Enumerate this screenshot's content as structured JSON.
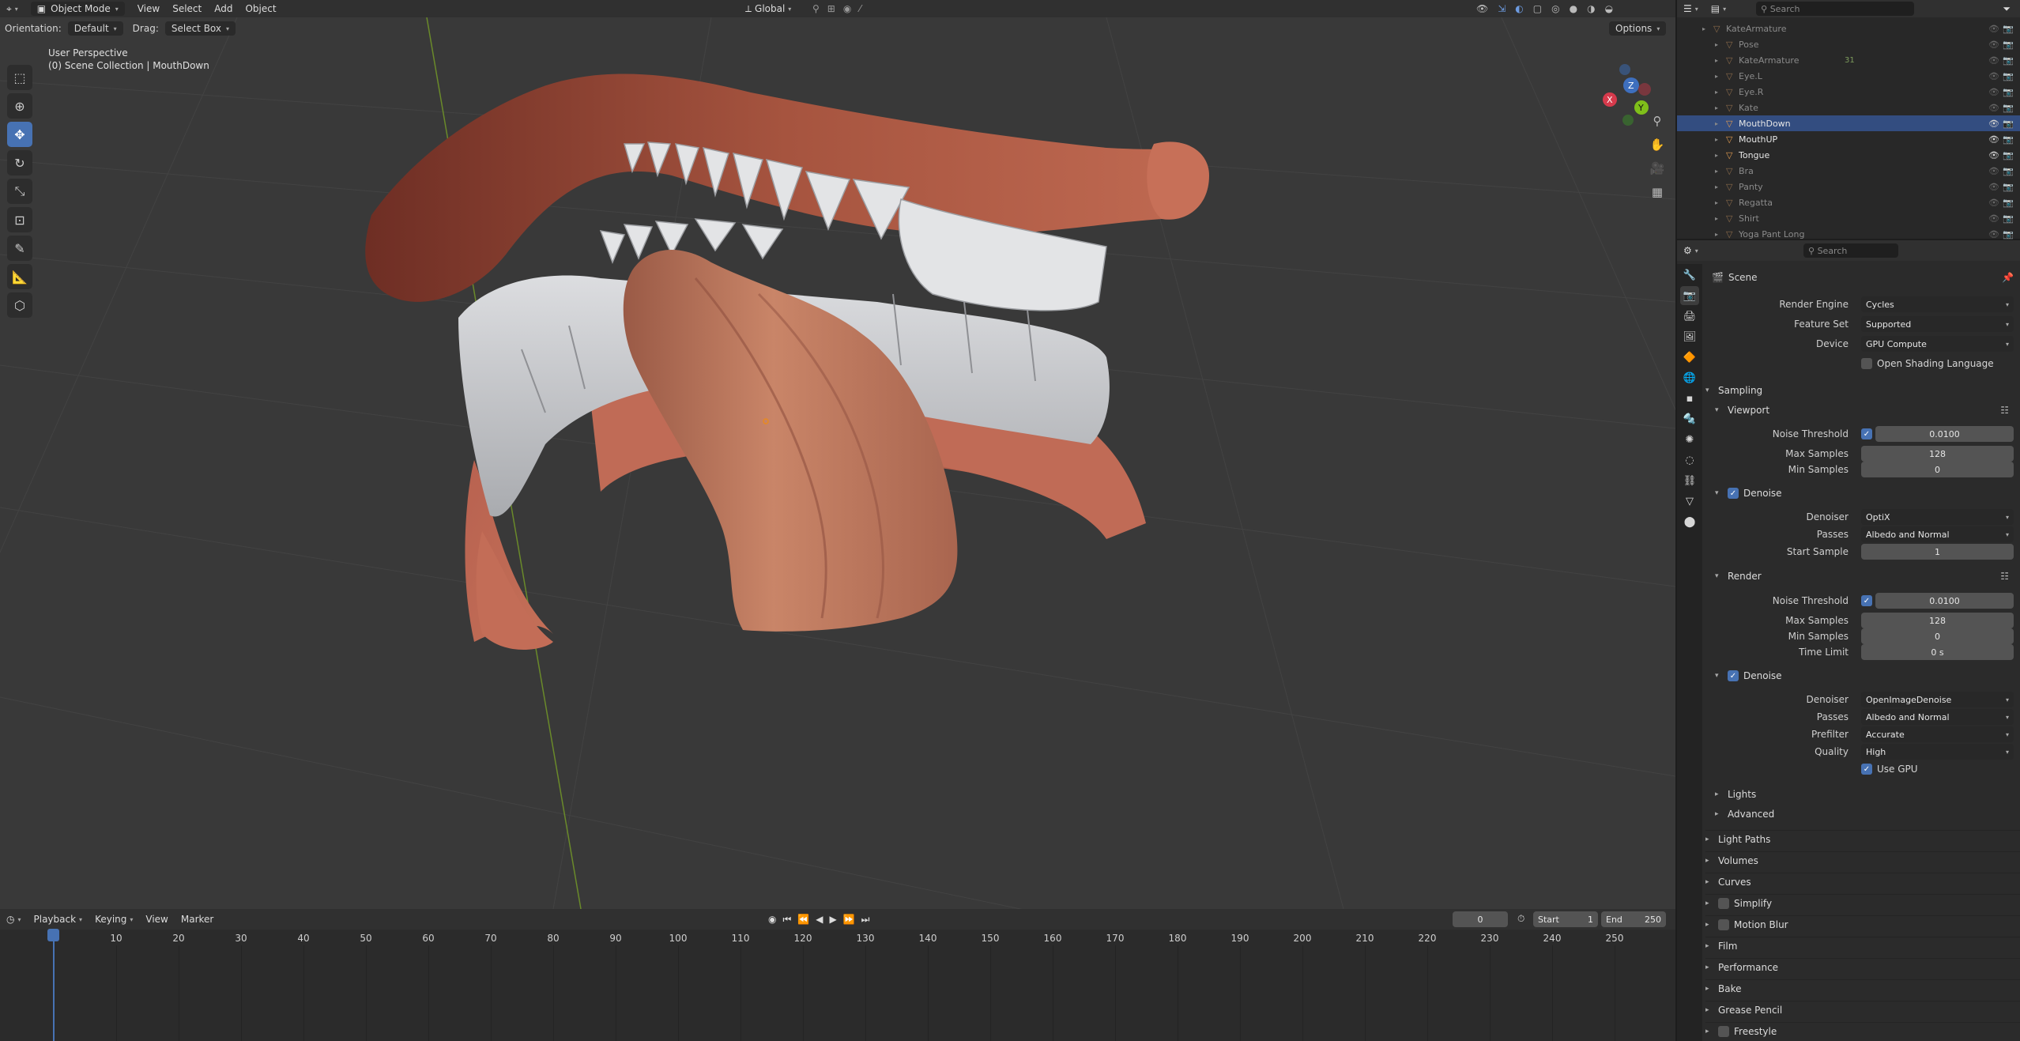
{
  "header": {
    "mode": "Object Mode",
    "menus": [
      "View",
      "Select",
      "Add",
      "Object"
    ],
    "transform_orientation": "Global",
    "search_placeholder": "Search"
  },
  "subheader": {
    "orientation_label": "Orientation:",
    "orientation_value": "Default",
    "drag_label": "Drag:",
    "drag_value": "Select Box",
    "options": "Options"
  },
  "viewport": {
    "perspective": "User Perspective",
    "collection": "(0) Scene Collection | MouthDown",
    "axes": {
      "x": "X",
      "y": "Y",
      "z": "Z"
    }
  },
  "timeline": {
    "menus": [
      "Playback",
      "Keying",
      "View",
      "Marker"
    ],
    "current_frame": "0",
    "start_label": "Start",
    "start": "1",
    "end_label": "End",
    "end": "250",
    "ruler": [
      "0",
      "10",
      "20",
      "30",
      "40",
      "50",
      "60",
      "70",
      "80",
      "90",
      "100",
      "110",
      "120",
      "130",
      "140",
      "150",
      "160",
      "170",
      "180",
      "190",
      "200",
      "210",
      "220",
      "230",
      "240",
      "250"
    ]
  },
  "outliner": {
    "search_placeholder": "Search",
    "items": [
      {
        "name": "KateArmature",
        "dim": true,
        "indent": 1
      },
      {
        "name": "Pose",
        "dim": true,
        "indent": 2
      },
      {
        "name": "KateArmature",
        "dim": true,
        "indent": 2,
        "extra": "31"
      },
      {
        "name": "Eye.L",
        "dim": true,
        "indent": 2
      },
      {
        "name": "Eye.R",
        "dim": true,
        "indent": 2
      },
      {
        "name": "Kate",
        "dim": true,
        "indent": 2
      },
      {
        "name": "MouthDown",
        "dim": false,
        "indent": 2
      },
      {
        "name": "MouthUP",
        "dim": false,
        "indent": 2
      },
      {
        "name": "Tongue",
        "dim": false,
        "indent": 2
      },
      {
        "name": "Bra",
        "dim": true,
        "indent": 2
      },
      {
        "name": "Panty",
        "dim": true,
        "indent": 2
      },
      {
        "name": "Regatta",
        "dim": true,
        "indent": 2
      },
      {
        "name": "Shirt",
        "dim": true,
        "indent": 2
      },
      {
        "name": "Yoga Pant Long",
        "dim": true,
        "indent": 2
      }
    ]
  },
  "properties": {
    "search_placeholder": "Search",
    "context": "Scene",
    "render_engine_label": "Render Engine",
    "render_engine": "Cycles",
    "feature_set_label": "Feature Set",
    "feature_set": "Supported",
    "device_label": "Device",
    "device": "GPU Compute",
    "osl": "Open Shading Language",
    "sampling": "Sampling",
    "viewport_sub": "Viewport",
    "vp_noise_label": "Noise Threshold",
    "vp_noise": "0.0100",
    "vp_max_label": "Max Samples",
    "vp_max": "128",
    "vp_min_label": "Min Samples",
    "vp_min": "0",
    "vp_denoise": "Denoise",
    "vp_denoiser_label": "Denoiser",
    "vp_denoiser": "OptiX",
    "vp_passes_label": "Passes",
    "vp_passes": "Albedo and Normal",
    "vp_start_label": "Start Sample",
    "vp_start": "1",
    "render_sub": "Render",
    "r_noise_label": "Noise Threshold",
    "r_noise": "0.0100",
    "r_max_label": "Max Samples",
    "r_max": "128",
    "r_min_label": "Min Samples",
    "r_min": "0",
    "r_time_label": "Time Limit",
    "r_time": "0 s",
    "r_denoise": "Denoise",
    "r_denoiser_label": "Denoiser",
    "r_denoiser": "OpenImageDenoise",
    "r_passes_label": "Passes",
    "r_passes": "Albedo and Normal",
    "r_prefilter_label": "Prefilter",
    "r_prefilter": "Accurate",
    "r_quality_label": "Quality",
    "r_quality": "High",
    "r_use_gpu": "Use GPU",
    "lights": "Lights",
    "advanced": "Advanced",
    "panels": [
      "Light Paths",
      "Volumes",
      "Curves",
      "Simplify",
      "Motion Blur",
      "Film",
      "Performance",
      "Bake",
      "Grease Pencil",
      "Freestyle"
    ]
  }
}
